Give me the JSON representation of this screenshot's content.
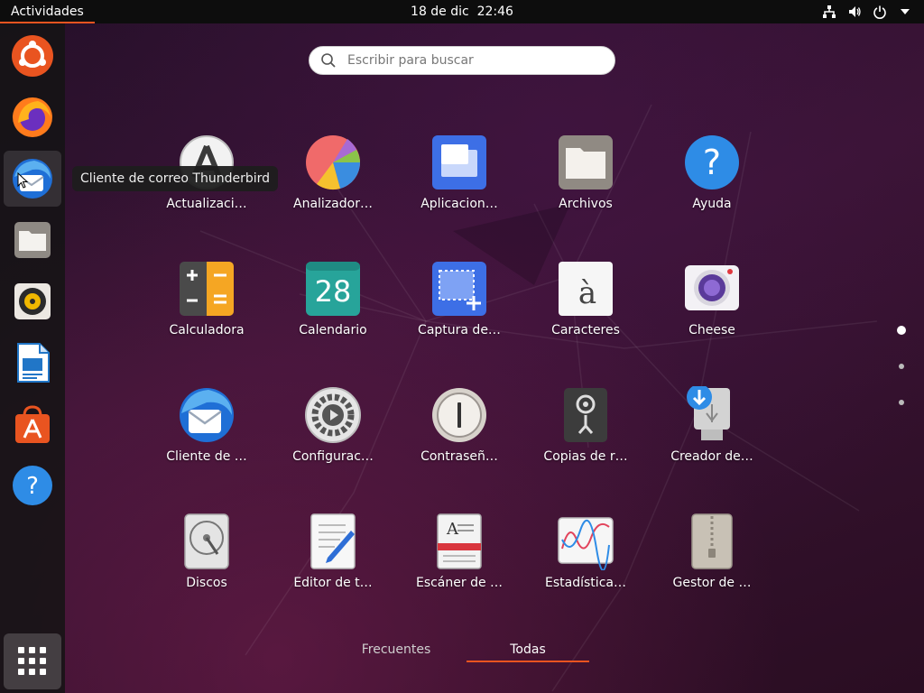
{
  "topbar": {
    "activities_label": "Actividades",
    "clock": "18 de dic  22:46",
    "accent": "#e95420"
  },
  "dock": {
    "items": [
      {
        "name": "ubuntu-software-updater-icon"
      },
      {
        "name": "firefox-icon"
      },
      {
        "name": "thunderbird-icon",
        "active": true
      },
      {
        "name": "files-icon"
      },
      {
        "name": "rhythmbox-icon"
      },
      {
        "name": "libreoffice-writer-icon"
      },
      {
        "name": "ubuntu-software-icon"
      },
      {
        "name": "help-icon"
      }
    ],
    "grid_button": "show-applications-icon"
  },
  "tooltip": {
    "text": "Cliente de correo Thunderbird"
  },
  "search": {
    "placeholder": "Escribir para buscar",
    "value": ""
  },
  "apps": [
    {
      "label": "Actualizaci…",
      "icon": "software-updater-icon"
    },
    {
      "label": "Analizador…",
      "icon": "disk-usage-pie-icon"
    },
    {
      "label": "Aplicacion…",
      "icon": "applications-window-icon"
    },
    {
      "label": "Archivos",
      "icon": "folder-icon"
    },
    {
      "label": "Ayuda",
      "icon": "help-icon"
    },
    {
      "label": "Calculadora",
      "icon": "calculator-icon"
    },
    {
      "label": "Calendario",
      "icon": "calendar-icon",
      "day": "28"
    },
    {
      "label": "Captura de…",
      "icon": "screenshot-icon"
    },
    {
      "label": "Caracteres",
      "icon": "characters-icon",
      "glyph": "à"
    },
    {
      "label": "Cheese",
      "icon": "webcam-icon"
    },
    {
      "label": "Cliente de …",
      "icon": "thunderbird-icon"
    },
    {
      "label": "Configurac…",
      "icon": "settings-gear-icon"
    },
    {
      "label": "Contraseñ…",
      "icon": "passwords-keyhole-icon"
    },
    {
      "label": "Copias de r…",
      "icon": "backups-safe-icon"
    },
    {
      "label": "Creador de…",
      "icon": "usb-creator-icon"
    },
    {
      "label": "Discos",
      "icon": "disks-icon"
    },
    {
      "label": "Editor de t…",
      "icon": "text-editor-icon"
    },
    {
      "label": "Escáner de …",
      "icon": "scanner-icon",
      "glyph": "A"
    },
    {
      "label": "Estadística…",
      "icon": "statistics-chart-icon"
    },
    {
      "label": "Gestor de …",
      "icon": "archive-manager-icon"
    }
  ],
  "pager": {
    "current": 1,
    "total": 3
  },
  "tabs": [
    {
      "label": "Frecuentes",
      "active": false
    },
    {
      "label": "Todas",
      "active": true
    }
  ]
}
